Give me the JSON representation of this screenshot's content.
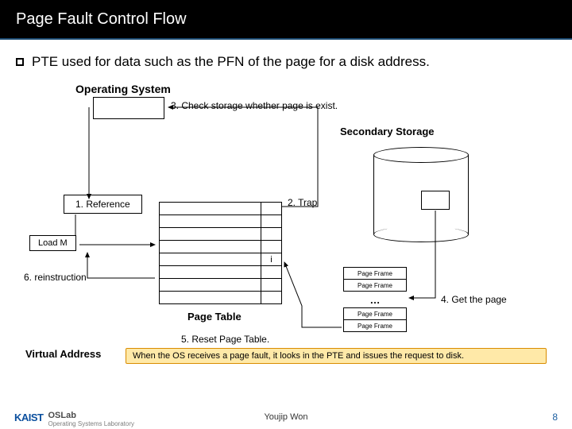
{
  "header": {
    "title": "Page Fault Control Flow"
  },
  "bullet": "PTE used for data such as the PFN of the page for a disk address.",
  "labels": {
    "os": "Operating System",
    "step3": "3. Check storage whether page is exist.",
    "secondary": "Secondary Storage",
    "reference": "1. Reference",
    "trap": "2. Trap",
    "loadm": "Load M",
    "ptable": "Page Table",
    "step5": "5. Reset Page Table.",
    "reinstr": "6. reinstruction",
    "step4": "4. Get the page",
    "va": "Virtual Address",
    "pt_i": "i",
    "pframe": "Page Frame",
    "dots": "…"
  },
  "callout": "When the OS receives a page fault, it looks in the PTE and issues the request to disk.",
  "footer": {
    "brand_k": "KAIST",
    "brand_os": "OSLab",
    "brand_sub": "Operating Systems Laboratory",
    "author": "Youjip Won",
    "page": "8"
  }
}
